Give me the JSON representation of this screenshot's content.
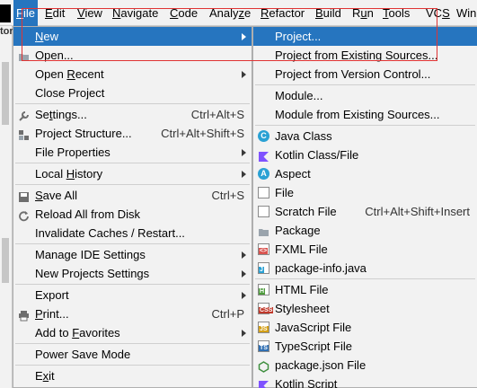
{
  "menubar": {
    "items": [
      {
        "mn": "F",
        "rest": "ile"
      },
      {
        "mn": "E",
        "rest": "dit"
      },
      {
        "mn": "V",
        "rest": "iew"
      },
      {
        "mn": "N",
        "rest": "avigate"
      },
      {
        "mn": "C",
        "rest": "ode"
      },
      {
        "pre": "Analy",
        "mn": "z",
        "rest": "e"
      },
      {
        "mn": "R",
        "rest": "efactor"
      },
      {
        "mn": "B",
        "rest": "uild"
      },
      {
        "pre": "R",
        "mn": "u",
        "rest": "n"
      },
      {
        "mn": "T",
        "rest": "ools"
      },
      {
        "pre": "VC",
        "mn": "S",
        "rest": ""
      },
      {
        "pre": "Win",
        "mn": "",
        "rest": ""
      }
    ]
  },
  "frag_label": "tor",
  "file_menu": {
    "items": [
      {
        "pre": "",
        "mn": "N",
        "rest": "ew",
        "shortcut": "",
        "submenu": true,
        "icon": ""
      },
      {
        "pre": "",
        "mn": "O",
        "rest": "pen...",
        "shortcut": "",
        "submenu": false,
        "icon": "folder-open-icon"
      },
      {
        "pre": "Open ",
        "mn": "R",
        "rest": "ecent",
        "shortcut": "",
        "submenu": true,
        "icon": ""
      },
      {
        "pre": "Close Project",
        "mn": "",
        "rest": "",
        "shortcut": "",
        "submenu": false,
        "icon": ""
      },
      {
        "pre": "Se",
        "mn": "t",
        "rest": "tings...",
        "shortcut": "Ctrl+Alt+S",
        "submenu": false,
        "icon": "wrench-icon"
      },
      {
        "pre": "Project Structure...",
        "mn": "",
        "rest": "",
        "shortcut": "Ctrl+Alt+Shift+S",
        "submenu": false,
        "icon": "project-structure-icon"
      },
      {
        "pre": "File Properties",
        "mn": "",
        "rest": "",
        "shortcut": "",
        "submenu": true,
        "icon": ""
      },
      {
        "pre": "Local ",
        "mn": "H",
        "rest": "istory",
        "shortcut": "",
        "submenu": true,
        "icon": ""
      },
      {
        "pre": "",
        "mn": "S",
        "rest": "ave All",
        "shortcut": "Ctrl+S",
        "submenu": false,
        "icon": "save-icon"
      },
      {
        "pre": "Reload All from Disk",
        "mn": "",
        "rest": "",
        "shortcut": "",
        "submenu": false,
        "icon": "reload-icon"
      },
      {
        "pre": "Invalidate Caches / Restart...",
        "mn": "",
        "rest": "",
        "shortcut": "",
        "submenu": false,
        "icon": ""
      },
      {
        "pre": "Manage IDE Settings",
        "mn": "",
        "rest": "",
        "shortcut": "",
        "submenu": true,
        "icon": ""
      },
      {
        "pre": "New Projects Settings",
        "mn": "",
        "rest": "",
        "shortcut": "",
        "submenu": true,
        "icon": ""
      },
      {
        "pre": "Export",
        "mn": "",
        "rest": "",
        "shortcut": "",
        "submenu": true,
        "icon": ""
      },
      {
        "pre": "",
        "mn": "P",
        "rest": "rint...",
        "shortcut": "Ctrl+P",
        "submenu": false,
        "icon": "print-icon"
      },
      {
        "pre": "Add to ",
        "mn": "F",
        "rest": "avorites",
        "shortcut": "",
        "submenu": true,
        "icon": ""
      },
      {
        "pre": "Power Save Mode",
        "mn": "",
        "rest": "",
        "shortcut": "",
        "submenu": false,
        "icon": ""
      },
      {
        "pre": "E",
        "mn": "x",
        "rest": "it",
        "shortcut": "",
        "submenu": false,
        "icon": ""
      }
    ]
  },
  "new_menu": {
    "items": [
      {
        "label": "Project...",
        "shortcut": "",
        "icon": ""
      },
      {
        "label": "Project from Existing Sources...",
        "shortcut": "",
        "icon": ""
      },
      {
        "label": "Project from Version Control...",
        "shortcut": "",
        "icon": ""
      },
      {
        "label": "Module...",
        "shortcut": "",
        "icon": ""
      },
      {
        "label": "Module from Existing Sources...",
        "shortcut": "",
        "icon": ""
      },
      {
        "label": "Java Class",
        "shortcut": "",
        "icon": "java-class-icon",
        "badge": "C",
        "color": "#2aa1d4"
      },
      {
        "label": "Kotlin Class/File",
        "shortcut": "",
        "icon": "kotlin-icon",
        "badge": "",
        "color": "#7f52ff"
      },
      {
        "label": "Aspect",
        "shortcut": "",
        "icon": "aspect-icon",
        "badge": "A",
        "color": "#2aa1d4"
      },
      {
        "label": "File",
        "shortcut": "",
        "icon": "file-icon"
      },
      {
        "label": "Scratch File",
        "shortcut": "Ctrl+Alt+Shift+Insert",
        "icon": "scratch-file-icon"
      },
      {
        "label": "Package",
        "shortcut": "",
        "icon": "package-icon"
      },
      {
        "label": "FXML File",
        "shortcut": "",
        "icon": "fxml-file-icon",
        "badge": "<>",
        "color": "#d9534f"
      },
      {
        "label": "package-info.java",
        "shortcut": "",
        "icon": "package-info-icon",
        "badge": "J",
        "color": "#2aa1d4"
      },
      {
        "label": "HTML File",
        "shortcut": "",
        "icon": "html-file-icon",
        "badge": "H",
        "color": "#4c9a3b"
      },
      {
        "label": "Stylesheet",
        "shortcut": "",
        "icon": "stylesheet-icon",
        "badge": "CSS",
        "color": "#c0392b"
      },
      {
        "label": "JavaScript File",
        "shortcut": "",
        "icon": "javascript-file-icon",
        "badge": "JS",
        "color": "#d4a017"
      },
      {
        "label": "TypeScript File",
        "shortcut": "",
        "icon": "typescript-file-icon",
        "badge": "TS",
        "color": "#2f6fb3"
      },
      {
        "label": "package.json File",
        "shortcut": "",
        "icon": "package-json-icon",
        "badge": "",
        "color": "#3f8f3f"
      },
      {
        "label": "Kotlin Script",
        "shortcut": "",
        "icon": "kotlin-script-icon",
        "badge": "",
        "color": "#7f52ff"
      }
    ]
  },
  "colors": {
    "highlight": "#2675bf",
    "menu_bg": "#f2f2f2",
    "annotation_box": "#e03434"
  }
}
